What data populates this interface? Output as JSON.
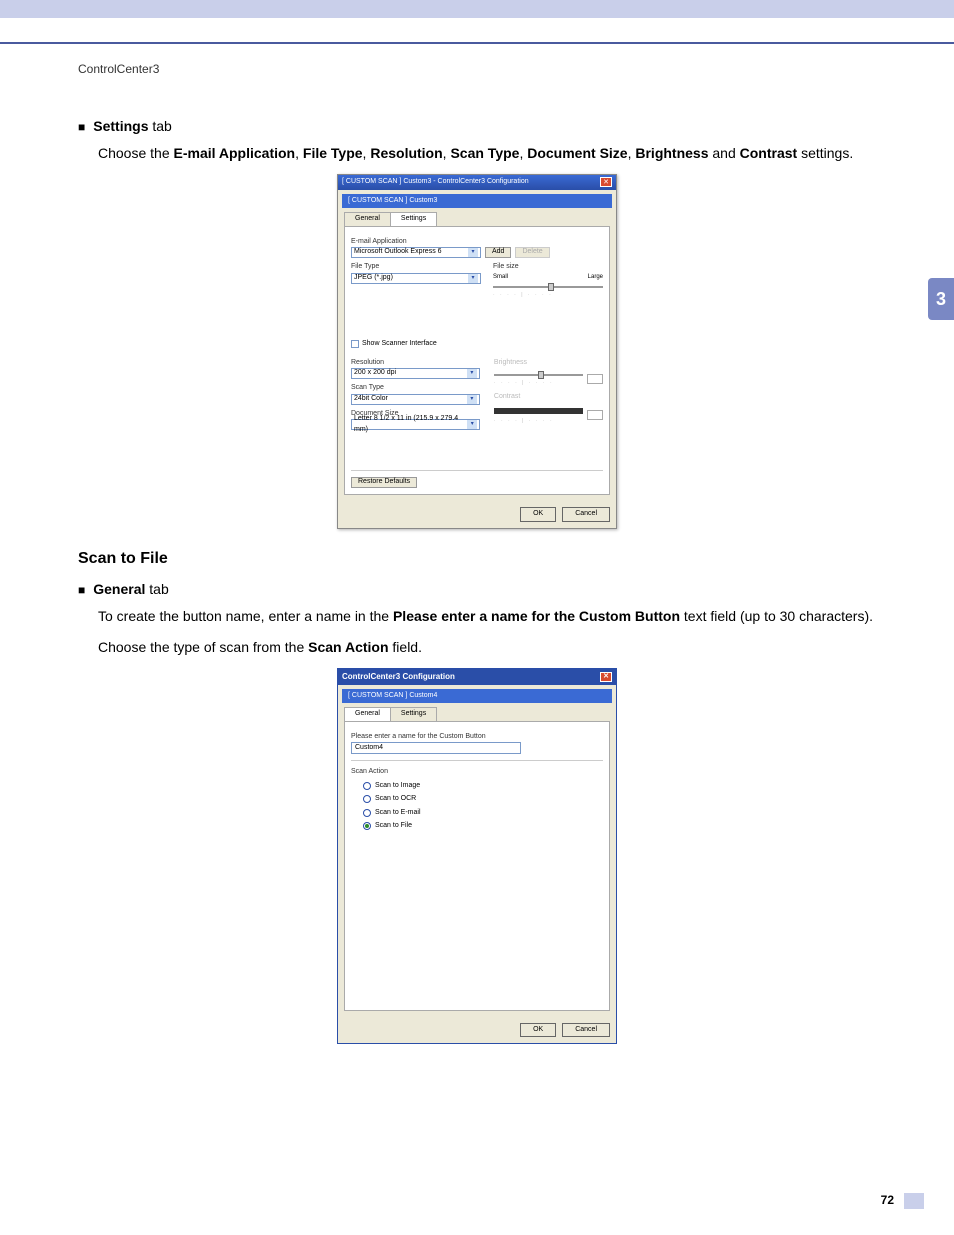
{
  "header": {
    "breadcrumb": "ControlCenter3"
  },
  "sidetab": {
    "num": "3"
  },
  "pagenum": "72",
  "sec1": {
    "bullet_label": "Settings",
    "bullet_suffix": " tab",
    "para_pre": "Choose the ",
    "b1": "E-mail Application",
    "c1": ", ",
    "b2": "File Type",
    "c2": ", ",
    "b3": "Resolution",
    "c3": ", ",
    "b4": "Scan Type",
    "c4": ", ",
    "b5": "Document Size",
    "c5": ", ",
    "b6": "Brightness",
    "c6": " and ",
    "b7": "Contrast",
    "para_post": " settings."
  },
  "dlg1": {
    "title": "[ CUSTOM SCAN ]  Custom3 - ControlCenter3 Configuration",
    "sub": "[ CUSTOM SCAN ]  Custom3",
    "tab_general": "General",
    "tab_settings": "Settings",
    "lbl_email": "E-mail Application",
    "val_email": "Microsoft Outlook Express 6",
    "btn_add": "Add",
    "btn_delete": "Delete",
    "lbl_filetype": "File Type",
    "val_filetype": "JPEG (*.jpg)",
    "lbl_filesize": "File size",
    "fs_small": "Small",
    "fs_large": "Large",
    "chk_show": "Show Scanner Interface",
    "lbl_res": "Resolution",
    "val_res": "200 x 200 dpi",
    "lbl_scantype": "Scan Type",
    "val_scantype": "24bit Color",
    "lbl_docsize": "Document Size",
    "val_docsize": "Letter 8 1/2 x 11 in (215.9 x 279.4 mm)",
    "lbl_bright": "Brightness",
    "lbl_contrast": "Contrast",
    "btn_restore": "Restore Defaults",
    "btn_ok": "OK",
    "btn_cancel": "Cancel"
  },
  "sec2": {
    "title": "Scan to File",
    "bullet_label": "General",
    "bullet_suffix": " tab",
    "p1_pre": "To create the button name, enter a name in the ",
    "p1_b": "Please enter a name for the Custom Button",
    "p1_post": " text field (up to 30 characters).",
    "p2_pre": "Choose the type of scan from the ",
    "p2_b": "Scan Action",
    "p2_post": " field."
  },
  "dlg2": {
    "title": "ControlCenter3 Configuration",
    "sub": "[ CUSTOM SCAN ]  Custom4",
    "tab_general": "General",
    "tab_settings": "Settings",
    "lbl_name": "Please enter a name for the Custom Button",
    "val_name": "Custom4",
    "lbl_action": "Scan Action",
    "r1": "Scan to Image",
    "r2": "Scan to OCR",
    "r3": "Scan to E-mail",
    "r4": "Scan to File",
    "btn_ok": "OK",
    "btn_cancel": "Cancel"
  }
}
